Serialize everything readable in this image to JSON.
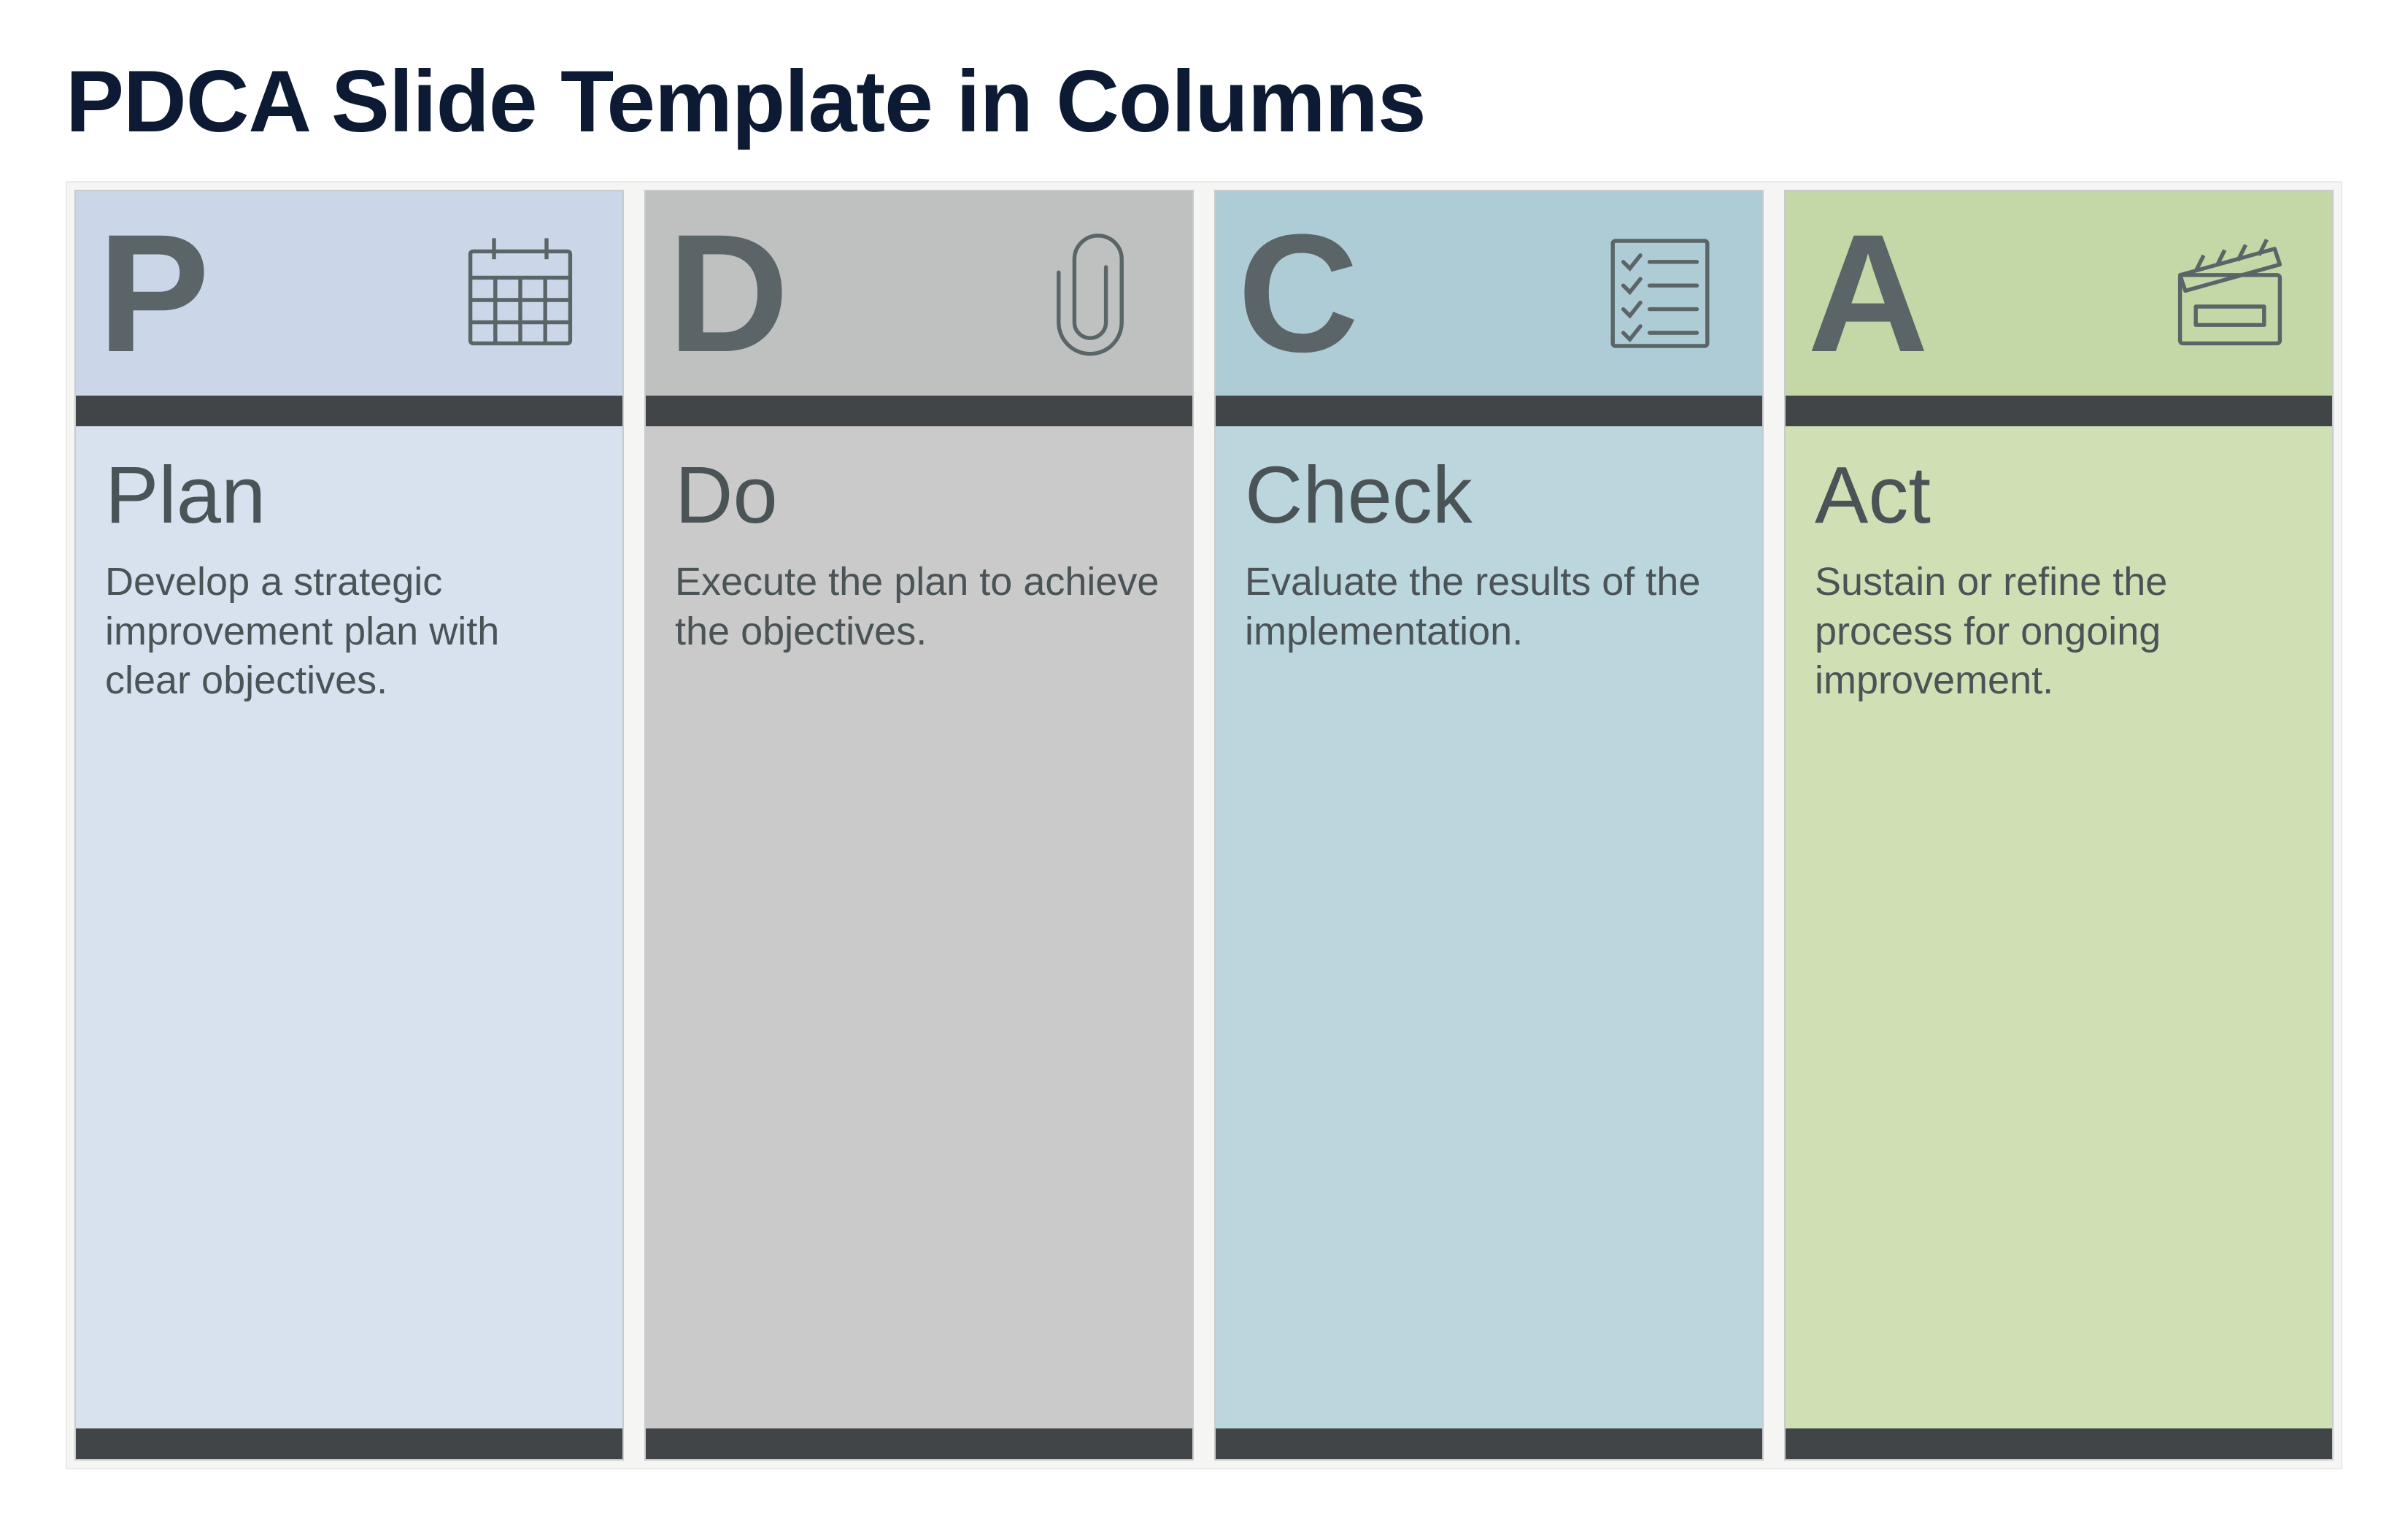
{
  "title": "PDCA Slide Template in Columns",
  "columns": [
    {
      "letter": "P",
      "word": "Plan",
      "desc": "Develop a strategic improvement plan with clear objectives.",
      "icon": "calendar-icon",
      "body_bg": "bg-plan",
      "head_bg": "hd-plan"
    },
    {
      "letter": "D",
      "word": "Do",
      "desc": "Execute the plan to achieve the objectives.",
      "icon": "paperclip-icon",
      "body_bg": "bg-do",
      "head_bg": "hd-do"
    },
    {
      "letter": "C",
      "word": "Check",
      "desc": "Evaluate the results of the implementation.",
      "icon": "checklist-icon",
      "body_bg": "bg-check",
      "head_bg": "hd-check"
    },
    {
      "letter": "A",
      "word": "Act",
      "desc": "Sustain or refine the process for ongoing improvement.",
      "icon": "clapperboard-icon",
      "body_bg": "bg-act",
      "head_bg": "hd-act"
    }
  ],
  "colors": {
    "title": "#0d1a33",
    "divider": "#414548",
    "plan_bg": "#d8e1ee",
    "do_bg": "#c9cac9",
    "check_bg": "#bcd6de",
    "act_bg": "#cfe0b4"
  }
}
